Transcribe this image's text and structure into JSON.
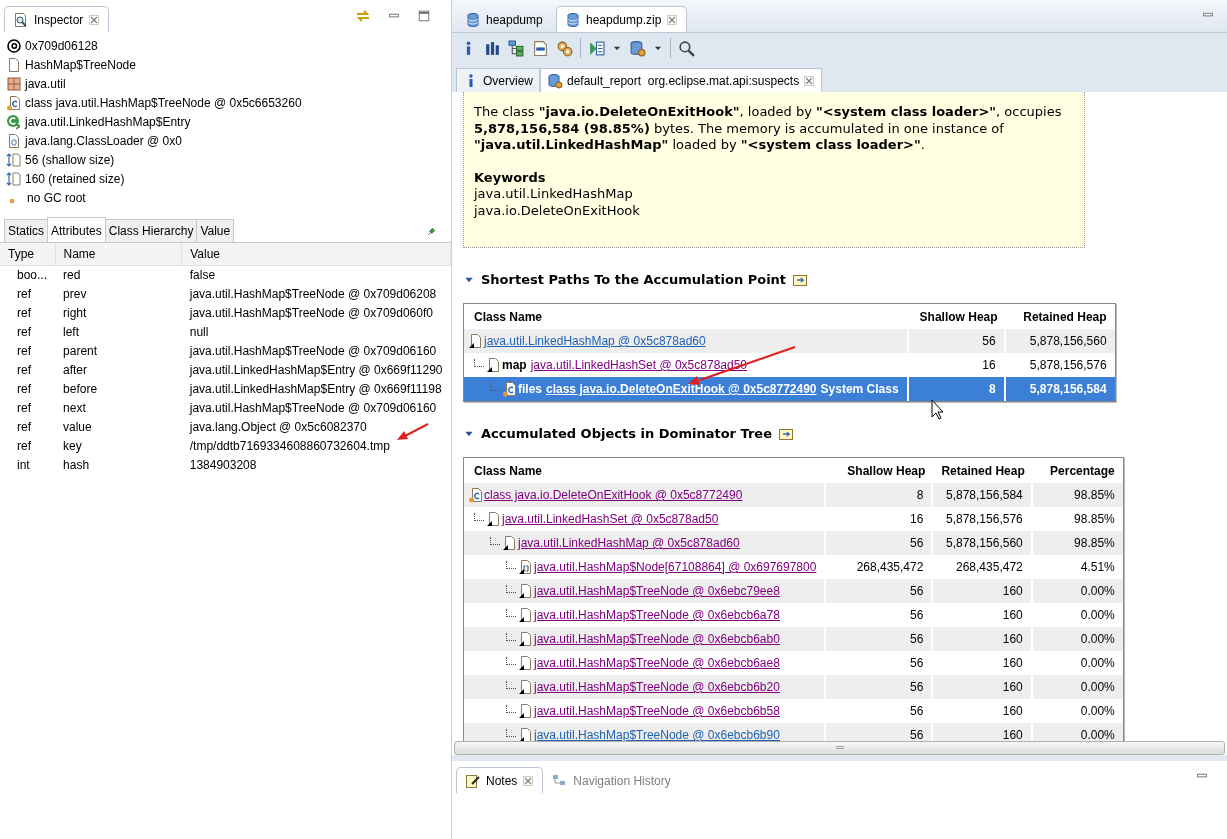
{
  "inspector": {
    "title": "Inspector",
    "info": [
      {
        "kind": "address",
        "text": "0x709d06128"
      },
      {
        "kind": "type",
        "text": "HashMap$TreeNode"
      },
      {
        "kind": "package",
        "text": "java.util"
      },
      {
        "kind": "class",
        "text": "class java.util.HashMap$TreeNode @ 0x5c6653260"
      },
      {
        "kind": "superclass",
        "text": "java.util.LinkedHashMap$Entry"
      },
      {
        "kind": "classloader",
        "text": "java.lang.ClassLoader @ 0x0"
      },
      {
        "kind": "size",
        "text": "56 (shallow size)"
      },
      {
        "kind": "size",
        "text": "160 (retained size)"
      },
      {
        "kind": "gc",
        "text": "no GC root"
      }
    ],
    "tabs": [
      {
        "label": "Statics",
        "selected": false
      },
      {
        "label": "Attributes",
        "selected": true
      },
      {
        "label": "Class Hierarchy",
        "selected": false
      },
      {
        "label": "Value",
        "selected": false
      }
    ],
    "columns": [
      "Type",
      "Name",
      "Value"
    ],
    "rows": [
      {
        "type": "boo...",
        "name": "red",
        "value": "false"
      },
      {
        "type": "ref",
        "name": "prev",
        "value": "java.util.HashMap$TreeNode @ 0x709d06208"
      },
      {
        "type": "ref",
        "name": "right",
        "value": "java.util.HashMap$TreeNode @ 0x709d060f0"
      },
      {
        "type": "ref",
        "name": "left",
        "value": "null"
      },
      {
        "type": "ref",
        "name": "parent",
        "value": "java.util.HashMap$TreeNode @ 0x709d06160"
      },
      {
        "type": "ref",
        "name": "after",
        "value": "java.util.LinkedHashMap$Entry @ 0x669f11290"
      },
      {
        "type": "ref",
        "name": "before",
        "value": "java.util.LinkedHashMap$Entry @ 0x669f11198"
      },
      {
        "type": "ref",
        "name": "next",
        "value": "java.util.HashMap$TreeNode @ 0x709d06160"
      },
      {
        "type": "ref",
        "name": "value",
        "value": "java.lang.Object @ 0x5c6082370"
      },
      {
        "type": "ref",
        "name": "key",
        "value": "/tmp/ddtb7169334608860732604.tmp"
      },
      {
        "type": "int",
        "name": "hash",
        "value": "1384903208"
      }
    ]
  },
  "editor_tabs": [
    {
      "label": "heapdump",
      "selected": false
    },
    {
      "label": "heapdump.zip",
      "selected": true
    }
  ],
  "report_tabs": [
    {
      "kind": "overview",
      "label": "Overview",
      "selected": false
    },
    {
      "kind": "report",
      "label": "default_report  org.eclipse.mat.api:suspects",
      "selected": true
    }
  ],
  "summary": {
    "text": "The class **\"java.io.DeleteOnExitHook\"**, loaded by **\"<system class loader>\"**, occupies **5,878,156,584 (98.85%)** bytes. The memory is accumulated in one instance of **\"java.util.LinkedHashMap\"** loaded by **\"<system class loader>\"**.",
    "keywords_title": "Keywords",
    "keywords": [
      "java.util.LinkedHashMap",
      "java.io.DeleteOnExitHook"
    ]
  },
  "paths": {
    "title": "Shortest Paths To the Accumulation Point",
    "columns": [
      "Class Name",
      "Shallow Heap",
      "Retained Heap"
    ],
    "rows": [
      {
        "kind": "object",
        "link": "java.util.LinkedHashMap @ 0x5c878ad60",
        "visited": false,
        "selected": false,
        "shallow": "56",
        "retained": "5,878,156,560",
        "children": [
          {
            "kind": "object",
            "field": "map",
            "link": "java.util.LinkedHashSet @ 0x5c878ad50",
            "visited": true,
            "selected": false,
            "shallow": "16",
            "retained": "5,878,156,576",
            "children": [
              {
                "kind": "class",
                "field": "files",
                "link": "class java.io.DeleteOnExitHook @ 0x5c8772490",
                "suffix": "System Class",
                "selected": true,
                "shallow": "8",
                "retained": "5,878,156,584"
              }
            ]
          }
        ]
      }
    ]
  },
  "dominator": {
    "title": "Accumulated Objects in Dominator Tree",
    "columns": [
      "Class Name",
      "Shallow Heap",
      "Retained Heap",
      "Percentage"
    ],
    "rows": [
      {
        "kind": "class",
        "link": "class java.io.DeleteOnExitHook @ 0x5c8772490",
        "visited": true,
        "shallow": "8",
        "retained": "5,878,156,584",
        "percentage": "98.85%",
        "children": [
          {
            "kind": "object",
            "link": "java.util.LinkedHashSet @ 0x5c878ad50",
            "visited": true,
            "shallow": "16",
            "retained": "5,878,156,576",
            "percentage": "98.85%",
            "children": [
              {
                "kind": "object",
                "link": "java.util.LinkedHashMap @ 0x5c878ad60",
                "visited": true,
                "shallow": "56",
                "retained": "5,878,156,560",
                "percentage": "98.85%",
                "children": [
                  {
                    "kind": "array",
                    "link": "java.util.HashMap$Node[67108864] @ 0x697697800",
                    "visited": true,
                    "shallow": "268,435,472",
                    "retained": "268,435,472",
                    "percentage": "4.51%"
                  },
                  {
                    "kind": "object",
                    "link": "java.util.HashMap$TreeNode @ 0x6ebc79ee8",
                    "visited": true,
                    "shallow": "56",
                    "retained": "160",
                    "percentage": "0.00%"
                  },
                  {
                    "kind": "object",
                    "link": "java.util.HashMap$TreeNode @ 0x6ebcb6a78",
                    "visited": true,
                    "shallow": "56",
                    "retained": "160",
                    "percentage": "0.00%"
                  },
                  {
                    "kind": "object",
                    "link": "java.util.HashMap$TreeNode @ 0x6ebcb6ab0",
                    "visited": true,
                    "shallow": "56",
                    "retained": "160",
                    "percentage": "0.00%"
                  },
                  {
                    "kind": "object",
                    "link": "java.util.HashMap$TreeNode @ 0x6ebcb6ae8",
                    "visited": true,
                    "shallow": "56",
                    "retained": "160",
                    "percentage": "0.00%"
                  },
                  {
                    "kind": "object",
                    "link": "java.util.HashMap$TreeNode @ 0x6ebcb6b20",
                    "visited": true,
                    "shallow": "56",
                    "retained": "160",
                    "percentage": "0.00%"
                  },
                  {
                    "kind": "object",
                    "link": "java.util.HashMap$TreeNode @ 0x6ebcb6b58",
                    "visited": true,
                    "shallow": "56",
                    "retained": "160",
                    "percentage": "0.00%"
                  },
                  {
                    "kind": "object",
                    "link": "java.util.HashMap$TreeNode @ 0x6ebcb6b90",
                    "visited": false,
                    "shallow": "56",
                    "retained": "160",
                    "percentage": "0.00%"
                  }
                ]
              }
            ]
          }
        ]
      }
    ]
  },
  "bottom_tabs": [
    {
      "label": "Notes",
      "selected": true
    },
    {
      "label": "Navigation History",
      "selected": false
    }
  ]
}
